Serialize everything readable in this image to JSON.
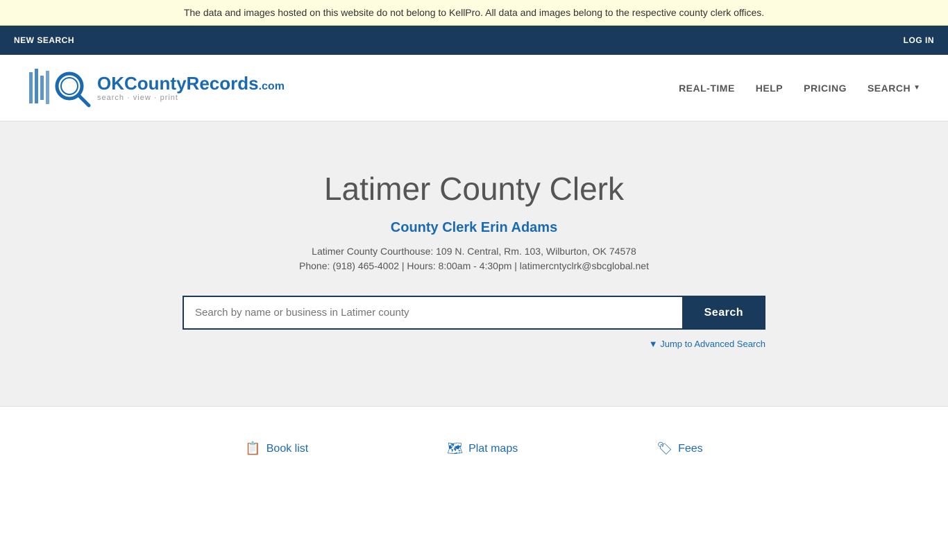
{
  "banner": {
    "text": "The data and images hosted on this website do not belong to KellPro. All data and images belong to the respective county clerk offices."
  },
  "topnav": {
    "new_search_label": "NEW SEARCH",
    "login_label": "LOG IN"
  },
  "header": {
    "logo_brand": "OKCountyRecords",
    "logo_tld": ".com",
    "logo_tagline": "search · view · print",
    "nav": {
      "realtime": "REAL-TIME",
      "help": "HELP",
      "pricing": "PRICING",
      "search": "SEARCH"
    }
  },
  "hero": {
    "title": "Latimer County Clerk",
    "clerk_name": "County Clerk Erin Adams",
    "address": "Latimer County Courthouse: 109 N. Central, Rm. 103, Wilburton, OK 74578",
    "phone_line": "Phone: (918) 465-4002 | Hours: 8:00am - 4:30pm | latimercntyclrk@sbcglobal.net",
    "search_placeholder": "Search by name or business in Latimer county",
    "search_button": "Search",
    "advanced_search": "▼ Jump to Advanced Search"
  },
  "footer": {
    "links": [
      {
        "icon": "📋",
        "label": "Book list"
      },
      {
        "icon": "🗺",
        "label": "Plat maps"
      },
      {
        "icon": "🏷",
        "label": "Fees"
      }
    ]
  }
}
